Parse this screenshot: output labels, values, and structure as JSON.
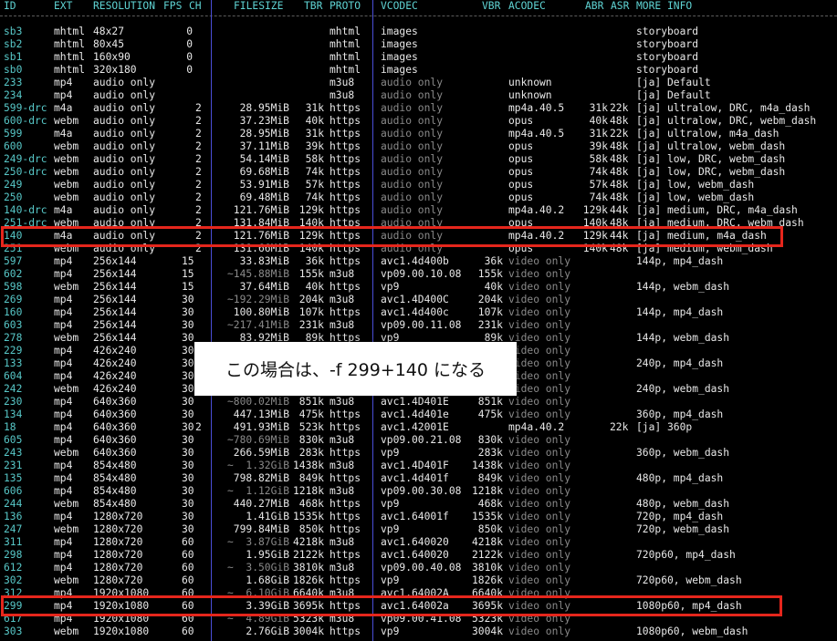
{
  "headers": {
    "id": "ID",
    "ext": "EXT",
    "res": "RESOLUTION",
    "fps": "FPS",
    "ch": "CH",
    "filesize": "FILESIZE",
    "tbr": "TBR",
    "proto": "PROTO",
    "vcodec": "VCODEC",
    "vbr": "VBR",
    "acodec": "ACODEC",
    "abr": "ABR",
    "asr": "ASR",
    "more": "MORE INFO"
  },
  "callout": "この場合は、-f 299+140 になる",
  "highlight_colors": {
    "box": "#e5261c",
    "id": "#57c7c7",
    "divider": "#4a4ed8"
  },
  "rows": [
    {
      "id": "sb3",
      "ext": "mhtml",
      "res": "48x27",
      "fps": "0",
      "ch": "",
      "fs": "",
      "tbr": "",
      "proto": "mhtml",
      "vc": "images",
      "vbr": "",
      "ac": "",
      "abr": "",
      "asr": "",
      "more": "storyboard"
    },
    {
      "id": "sb2",
      "ext": "mhtml",
      "res": "80x45",
      "fps": "0",
      "ch": "",
      "fs": "",
      "tbr": "",
      "proto": "mhtml",
      "vc": "images",
      "vbr": "",
      "ac": "",
      "abr": "",
      "asr": "",
      "more": "storyboard"
    },
    {
      "id": "sb1",
      "ext": "mhtml",
      "res": "160x90",
      "fps": "0",
      "ch": "",
      "fs": "",
      "tbr": "",
      "proto": "mhtml",
      "vc": "images",
      "vbr": "",
      "ac": "",
      "abr": "",
      "asr": "",
      "more": "storyboard"
    },
    {
      "id": "sb0",
      "ext": "mhtml",
      "res": "320x180",
      "fps": "0",
      "ch": "",
      "fs": "",
      "tbr": "",
      "proto": "mhtml",
      "vc": "images",
      "vbr": "",
      "ac": "",
      "abr": "",
      "asr": "",
      "more": "storyboard"
    },
    {
      "id": "233",
      "ext": "mp4",
      "res": "audio only",
      "fps": "",
      "ch": "",
      "fs": "",
      "tbr": "",
      "proto": "m3u8",
      "vc": "audio only",
      "vbr": "",
      "ac": "unknown",
      "abr": "",
      "asr": "",
      "more": "[ja] Default"
    },
    {
      "id": "234",
      "ext": "mp4",
      "res": "audio only",
      "fps": "",
      "ch": "",
      "fs": "",
      "tbr": "",
      "proto": "m3u8",
      "vc": "audio only",
      "vbr": "",
      "ac": "unknown",
      "abr": "",
      "asr": "",
      "more": "[ja] Default"
    },
    {
      "id": "599-drc",
      "ext": "m4a",
      "res": "audio only",
      "fps": "",
      "ch": "2",
      "fs": "28.95MiB",
      "tbr": "31k",
      "proto": "https",
      "vc": "audio only",
      "vbr": "",
      "ac": "mp4a.40.5",
      "abr": "31k",
      "asr": "22k",
      "more": "[ja] ultralow, DRC, m4a_dash"
    },
    {
      "id": "600-drc",
      "ext": "webm",
      "res": "audio only",
      "fps": "",
      "ch": "2",
      "fs": "37.23MiB",
      "tbr": "40k",
      "proto": "https",
      "vc": "audio only",
      "vbr": "",
      "ac": "opus",
      "abr": "40k",
      "asr": "48k",
      "more": "[ja] ultralow, DRC, webm_dash"
    },
    {
      "id": "599",
      "ext": "m4a",
      "res": "audio only",
      "fps": "",
      "ch": "2",
      "fs": "28.95MiB",
      "tbr": "31k",
      "proto": "https",
      "vc": "audio only",
      "vbr": "",
      "ac": "mp4a.40.5",
      "abr": "31k",
      "asr": "22k",
      "more": "[ja] ultralow, m4a_dash"
    },
    {
      "id": "600",
      "ext": "webm",
      "res": "audio only",
      "fps": "",
      "ch": "2",
      "fs": "37.11MiB",
      "tbr": "39k",
      "proto": "https",
      "vc": "audio only",
      "vbr": "",
      "ac": "opus",
      "abr": "39k",
      "asr": "48k",
      "more": "[ja] ultralow, webm_dash"
    },
    {
      "id": "249-drc",
      "ext": "webm",
      "res": "audio only",
      "fps": "",
      "ch": "2",
      "fs": "54.14MiB",
      "tbr": "58k",
      "proto": "https",
      "vc": "audio only",
      "vbr": "",
      "ac": "opus",
      "abr": "58k",
      "asr": "48k",
      "more": "[ja] low, DRC, webm_dash"
    },
    {
      "id": "250-drc",
      "ext": "webm",
      "res": "audio only",
      "fps": "",
      "ch": "2",
      "fs": "69.68MiB",
      "tbr": "74k",
      "proto": "https",
      "vc": "audio only",
      "vbr": "",
      "ac": "opus",
      "abr": "74k",
      "asr": "48k",
      "more": "[ja] low, DRC, webm_dash"
    },
    {
      "id": "249",
      "ext": "webm",
      "res": "audio only",
      "fps": "",
      "ch": "2",
      "fs": "53.91MiB",
      "tbr": "57k",
      "proto": "https",
      "vc": "audio only",
      "vbr": "",
      "ac": "opus",
      "abr": "57k",
      "asr": "48k",
      "more": "[ja] low, webm_dash"
    },
    {
      "id": "250",
      "ext": "webm",
      "res": "audio only",
      "fps": "",
      "ch": "2",
      "fs": "69.48MiB",
      "tbr": "74k",
      "proto": "https",
      "vc": "audio only",
      "vbr": "",
      "ac": "opus",
      "abr": "74k",
      "asr": "48k",
      "more": "[ja] low, webm_dash"
    },
    {
      "id": "140-drc",
      "ext": "m4a",
      "res": "audio only",
      "fps": "",
      "ch": "2",
      "fs": "121.76MiB",
      "tbr": "129k",
      "proto": "https",
      "vc": "audio only",
      "vbr": "",
      "ac": "mp4a.40.2",
      "abr": "129k",
      "asr": "44k",
      "more": "[ja] medium, DRC, m4a_dash"
    },
    {
      "id": "251-drc",
      "ext": "webm",
      "res": "audio only",
      "fps": "",
      "ch": "2",
      "fs": "131.84MiB",
      "tbr": "140k",
      "proto": "https",
      "vc": "audio only",
      "vbr": "",
      "ac": "opus",
      "abr": "140k",
      "asr": "48k",
      "more": "[ja] medium, DRC, webm_dash"
    },
    {
      "id": "140",
      "ext": "m4a",
      "res": "audio only",
      "fps": "",
      "ch": "2",
      "fs": "121.76MiB",
      "tbr": "129k",
      "proto": "https",
      "vc": "audio only",
      "vbr": "",
      "ac": "mp4a.40.2",
      "abr": "129k",
      "asr": "44k",
      "more": "[ja] medium, m4a_dash"
    },
    {
      "id": "251",
      "ext": "webm",
      "res": "audio only",
      "fps": "",
      "ch": "2",
      "fs": "131.66MiB",
      "tbr": "140k",
      "proto": "https",
      "vc": "audio only",
      "vbr": "",
      "ac": "opus",
      "abr": "140k",
      "asr": "48k",
      "more": "[ja] medium, webm_dash"
    },
    {
      "id": "597",
      "ext": "mp4",
      "res": "256x144",
      "fps": "15",
      "ch": "",
      "fs": "33.83MiB",
      "tbr": "36k",
      "proto": "https",
      "vc": "avc1.4d400b",
      "vbr": "36k",
      "ac": "video only",
      "abr": "",
      "asr": "",
      "more": "144p, mp4_dash"
    },
    {
      "id": "602",
      "ext": "mp4",
      "res": "256x144",
      "fps": "15",
      "ch": "",
      "fs": "~145.88MiB",
      "tbr": "155k",
      "proto": "m3u8",
      "vc": "vp09.00.10.08",
      "vbr": "155k",
      "ac": "video only",
      "abr": "",
      "asr": "",
      "more": ""
    },
    {
      "id": "598",
      "ext": "webm",
      "res": "256x144",
      "fps": "15",
      "ch": "",
      "fs": "37.64MiB",
      "tbr": "40k",
      "proto": "https",
      "vc": "vp9",
      "vbr": "40k",
      "ac": "video only",
      "abr": "",
      "asr": "",
      "more": "144p, webm_dash"
    },
    {
      "id": "269",
      "ext": "mp4",
      "res": "256x144",
      "fps": "30",
      "ch": "",
      "fs": "~192.29MiB",
      "tbr": "204k",
      "proto": "m3u8",
      "vc": "avc1.4D400C",
      "vbr": "204k",
      "ac": "video only",
      "abr": "",
      "asr": "",
      "more": ""
    },
    {
      "id": "160",
      "ext": "mp4",
      "res": "256x144",
      "fps": "30",
      "ch": "",
      "fs": "100.80MiB",
      "tbr": "107k",
      "proto": "https",
      "vc": "avc1.4d400c",
      "vbr": "107k",
      "ac": "video only",
      "abr": "",
      "asr": "",
      "more": "144p, mp4_dash"
    },
    {
      "id": "603",
      "ext": "mp4",
      "res": "256x144",
      "fps": "30",
      "ch": "",
      "fs": "~217.41MiB",
      "tbr": "231k",
      "proto": "m3u8",
      "vc": "vp09.00.11.08",
      "vbr": "231k",
      "ac": "video only",
      "abr": "",
      "asr": "",
      "more": ""
    },
    {
      "id": "278",
      "ext": "webm",
      "res": "256x144",
      "fps": "30",
      "ch": "",
      "fs": "83.92MiB",
      "tbr": "89k",
      "proto": "https",
      "vc": "vp9",
      "vbr": "89k",
      "ac": "video only",
      "abr": "",
      "asr": "",
      "more": "144p, webm_dash"
    },
    {
      "id": "229",
      "ext": "mp4",
      "res": "426x240",
      "fps": "30",
      "ch": "",
      "fs": "",
      "tbr": "",
      "proto": "",
      "vc": "",
      "vbr": "",
      "ac": "video only",
      "abr": "",
      "asr": "",
      "more": ""
    },
    {
      "id": "133",
      "ext": "mp4",
      "res": "426x240",
      "fps": "30",
      "ch": "",
      "fs": "",
      "tbr": "",
      "proto": "",
      "vc": "",
      "vbr": "",
      "ac": "video only",
      "abr": "",
      "asr": "",
      "more": "240p, mp4_dash"
    },
    {
      "id": "604",
      "ext": "mp4",
      "res": "426x240",
      "fps": "30",
      "ch": "",
      "fs": "",
      "tbr": "",
      "proto": "",
      "vc": "",
      "vbr": "",
      "ac": "video only",
      "abr": "",
      "asr": "",
      "more": ""
    },
    {
      "id": "242",
      "ext": "webm",
      "res": "426x240",
      "fps": "30",
      "ch": "",
      "fs": "",
      "tbr": "",
      "proto": "",
      "vc": "",
      "vbr": "",
      "ac": "video only",
      "abr": "",
      "asr": "",
      "more": "240p, webm_dash"
    },
    {
      "id": "230",
      "ext": "mp4",
      "res": "640x360",
      "fps": "30",
      "ch": "",
      "fs": "~800.02MiB",
      "tbr": "851k",
      "proto": "m3u8",
      "vc": "avc1.4D401E",
      "vbr": "851k",
      "ac": "video only",
      "abr": "",
      "asr": "",
      "more": ""
    },
    {
      "id": "134",
      "ext": "mp4",
      "res": "640x360",
      "fps": "30",
      "ch": "",
      "fs": "447.13MiB",
      "tbr": "475k",
      "proto": "https",
      "vc": "avc1.4d401e",
      "vbr": "475k",
      "ac": "video only",
      "abr": "",
      "asr": "",
      "more": "360p, mp4_dash"
    },
    {
      "id": "18",
      "ext": "mp4",
      "res": "640x360",
      "fps": "30",
      "ch": "2",
      "fs": "491.93MiB",
      "tbr": "523k",
      "proto": "https",
      "vc": "avc1.42001E",
      "vbr": "",
      "ac": "mp4a.40.2",
      "abr": "",
      "asr": "22k",
      "more": "[ja] 360p"
    },
    {
      "id": "605",
      "ext": "mp4",
      "res": "640x360",
      "fps": "30",
      "ch": "",
      "fs": "~780.69MiB",
      "tbr": "830k",
      "proto": "m3u8",
      "vc": "vp09.00.21.08",
      "vbr": "830k",
      "ac": "video only",
      "abr": "",
      "asr": "",
      "more": ""
    },
    {
      "id": "243",
      "ext": "webm",
      "res": "640x360",
      "fps": "30",
      "ch": "",
      "fs": "266.59MiB",
      "tbr": "283k",
      "proto": "https",
      "vc": "vp9",
      "vbr": "283k",
      "ac": "video only",
      "abr": "",
      "asr": "",
      "more": "360p, webm_dash"
    },
    {
      "id": "231",
      "ext": "mp4",
      "res": "854x480",
      "fps": "30",
      "ch": "",
      "fs": "~  1.32GiB",
      "tbr": "1438k",
      "proto": "m3u8",
      "vc": "avc1.4D401F",
      "vbr": "1438k",
      "ac": "video only",
      "abr": "",
      "asr": "",
      "more": ""
    },
    {
      "id": "135",
      "ext": "mp4",
      "res": "854x480",
      "fps": "30",
      "ch": "",
      "fs": "798.82MiB",
      "tbr": "849k",
      "proto": "https",
      "vc": "avc1.4d401f",
      "vbr": "849k",
      "ac": "video only",
      "abr": "",
      "asr": "",
      "more": "480p, mp4_dash"
    },
    {
      "id": "606",
      "ext": "mp4",
      "res": "854x480",
      "fps": "30",
      "ch": "",
      "fs": "~  1.12GiB",
      "tbr": "1218k",
      "proto": "m3u8",
      "vc": "vp09.00.30.08",
      "vbr": "1218k",
      "ac": "video only",
      "abr": "",
      "asr": "",
      "more": ""
    },
    {
      "id": "244",
      "ext": "webm",
      "res": "854x480",
      "fps": "30",
      "ch": "",
      "fs": "440.27MiB",
      "tbr": "468k",
      "proto": "https",
      "vc": "vp9",
      "vbr": "468k",
      "ac": "video only",
      "abr": "",
      "asr": "",
      "more": "480p, webm_dash"
    },
    {
      "id": "136",
      "ext": "mp4",
      "res": "1280x720",
      "fps": "30",
      "ch": "",
      "fs": "1.41GiB",
      "tbr": "1535k",
      "proto": "https",
      "vc": "avc1.64001f",
      "vbr": "1535k",
      "ac": "video only",
      "abr": "",
      "asr": "",
      "more": "720p, mp4_dash"
    },
    {
      "id": "247",
      "ext": "webm",
      "res": "1280x720",
      "fps": "30",
      "ch": "",
      "fs": "799.84MiB",
      "tbr": "850k",
      "proto": "https",
      "vc": "vp9",
      "vbr": "850k",
      "ac": "video only",
      "abr": "",
      "asr": "",
      "more": "720p, webm_dash"
    },
    {
      "id": "311",
      "ext": "mp4",
      "res": "1280x720",
      "fps": "60",
      "ch": "",
      "fs": "~  3.87GiB",
      "tbr": "4218k",
      "proto": "m3u8",
      "vc": "avc1.640020",
      "vbr": "4218k",
      "ac": "video only",
      "abr": "",
      "asr": "",
      "more": ""
    },
    {
      "id": "298",
      "ext": "mp4",
      "res": "1280x720",
      "fps": "60",
      "ch": "",
      "fs": "1.95GiB",
      "tbr": "2122k",
      "proto": "https",
      "vc": "avc1.640020",
      "vbr": "2122k",
      "ac": "video only",
      "abr": "",
      "asr": "",
      "more": "720p60, mp4_dash"
    },
    {
      "id": "612",
      "ext": "mp4",
      "res": "1280x720",
      "fps": "60",
      "ch": "",
      "fs": "~  3.50GiB",
      "tbr": "3810k",
      "proto": "m3u8",
      "vc": "vp09.00.40.08",
      "vbr": "3810k",
      "ac": "video only",
      "abr": "",
      "asr": "",
      "more": ""
    },
    {
      "id": "302",
      "ext": "webm",
      "res": "1280x720",
      "fps": "60",
      "ch": "",
      "fs": "1.68GiB",
      "tbr": "1826k",
      "proto": "https",
      "vc": "vp9",
      "vbr": "1826k",
      "ac": "video only",
      "abr": "",
      "asr": "",
      "more": "720p60, webm_dash"
    },
    {
      "id": "312",
      "ext": "mp4",
      "res": "1920x1080",
      "fps": "60",
      "ch": "",
      "fs": "~  6.10GiB",
      "tbr": "6640k",
      "proto": "m3u8",
      "vc": "avc1.64002A",
      "vbr": "6640k",
      "ac": "video only",
      "abr": "",
      "asr": "",
      "more": ""
    },
    {
      "id": "299",
      "ext": "mp4",
      "res": "1920x1080",
      "fps": "60",
      "ch": "",
      "fs": "3.39GiB",
      "tbr": "3695k",
      "proto": "https",
      "vc": "avc1.64002a",
      "vbr": "3695k",
      "ac": "video only",
      "abr": "",
      "asr": "",
      "more": "1080p60, mp4_dash"
    },
    {
      "id": "617",
      "ext": "mp4",
      "res": "1920x1080",
      "fps": "60",
      "ch": "",
      "fs": "~  4.89GiB",
      "tbr": "5323k",
      "proto": "m3u8",
      "vc": "vp09.00.41.08",
      "vbr": "5323k",
      "ac": "video only",
      "abr": "",
      "asr": "",
      "more": ""
    },
    {
      "id": "303",
      "ext": "webm",
      "res": "1920x1080",
      "fps": "60",
      "ch": "",
      "fs": "2.76GiB",
      "tbr": "3004k",
      "proto": "https",
      "vc": "vp9",
      "vbr": "3004k",
      "ac": "video only",
      "abr": "",
      "asr": "",
      "more": "1080p60, webm_dash"
    }
  ]
}
